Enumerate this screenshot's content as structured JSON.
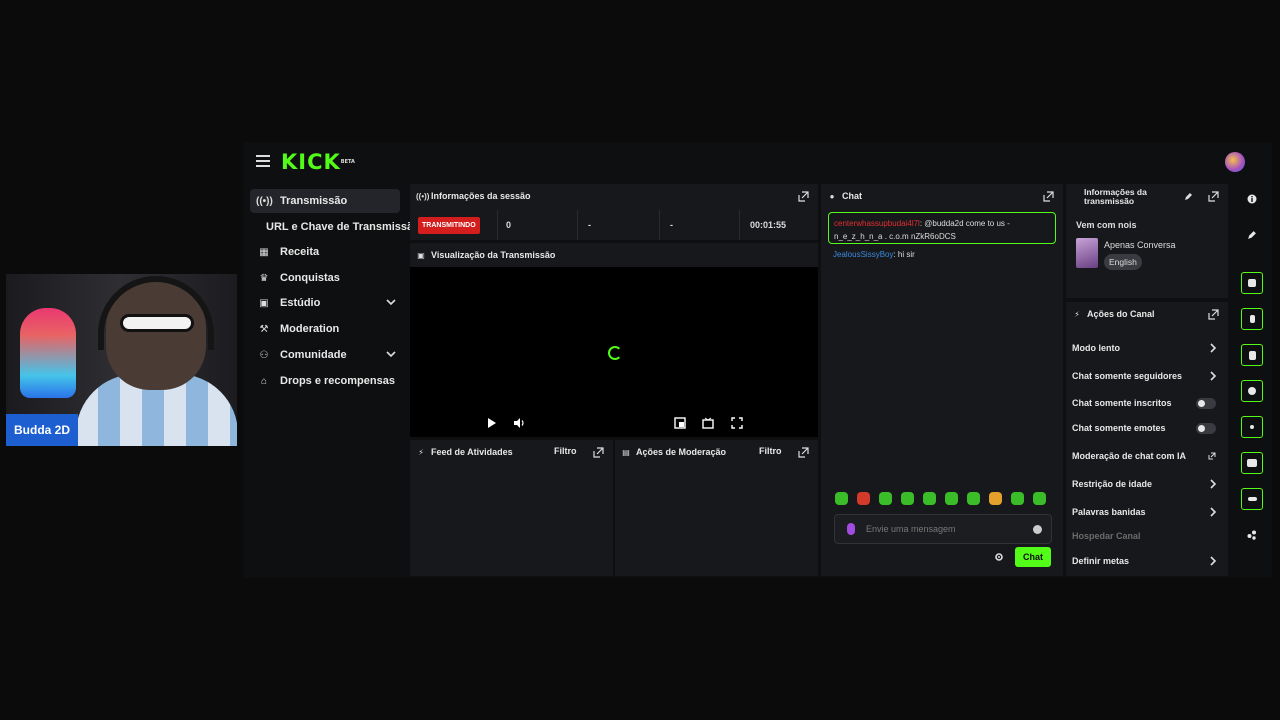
{
  "webcam": {
    "name_label": "Budda 2D"
  },
  "header": {
    "logo": "KICK",
    "logo_tag": "BETA"
  },
  "sidebar": {
    "items": [
      {
        "label": "Transmissão",
        "icon": "broadcast-icon"
      },
      {
        "label": "URL e Chave de Transmissão",
        "icon": ""
      },
      {
        "label": "Receita",
        "icon": "revenue-icon"
      },
      {
        "label": "Conquistas",
        "icon": "trophy-icon"
      },
      {
        "label": "Estúdio",
        "icon": "studio-icon"
      },
      {
        "label": "Moderation",
        "icon": "wrench-icon"
      },
      {
        "label": "Comunidade",
        "icon": "community-icon"
      },
      {
        "label": "Drops e recompensas",
        "icon": "gift-icon"
      }
    ]
  },
  "session": {
    "title": "Informações da sessão",
    "status": "TRANSMITINDO",
    "viewers": "0",
    "stat2": "-",
    "stat3": "-",
    "duration": "00:01:55"
  },
  "preview": {
    "title": "Visualização da Transmissão"
  },
  "feed": {
    "title": "Feed de Atividades",
    "filter": "Filtro"
  },
  "modact": {
    "title": "Ações de Moderação",
    "filter": "Filtro"
  },
  "chat": {
    "title": "Chat",
    "pinned_user": "centerwhassupbudai4l7l",
    "pinned_text": ": @budda2d come to us - n_e_z_h_n_a . c.o.m nZkR6oDCS",
    "msg_user": "JealousSissyBoy",
    "msg_text": ": hi sir",
    "input_placeholder": "Envie uma mensagem",
    "send_label": "Chat"
  },
  "stream_info": {
    "title": "Informações da transmissão",
    "stream_title": "Vem com nois",
    "category": "Apenas Conversa",
    "language": "English"
  },
  "channel_actions": {
    "title": "Ações do Canal",
    "rows": [
      {
        "label": "Modo lento",
        "control": "arrow"
      },
      {
        "label": "Chat somente seguidores",
        "control": "arrow"
      },
      {
        "label": "Chat somente inscritos",
        "control": "toggle"
      },
      {
        "label": "Chat somente emotes",
        "control": "toggle"
      },
      {
        "label": "Moderação de chat com IA",
        "control": "external"
      },
      {
        "label": "Restrição de idade",
        "control": "arrow"
      },
      {
        "label": "Palavras banidas",
        "control": "arrow"
      },
      {
        "label": "Hospedar Canal",
        "control": "disabled"
      },
      {
        "label": "Definir metas",
        "control": "arrow"
      }
    ]
  },
  "colors": {
    "accent": "#53fc18",
    "live": "#d41d1d",
    "bg": "#0e0f10",
    "panel": "#17181b"
  }
}
